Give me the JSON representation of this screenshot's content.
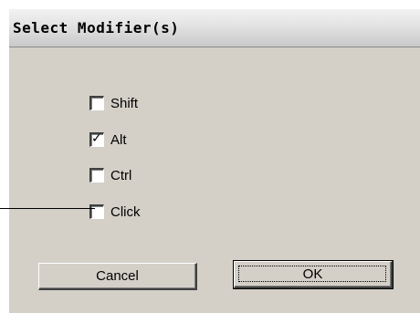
{
  "window": {
    "title": "Select Modifier(s)"
  },
  "modifiers": [
    {
      "label": "Shift",
      "checked": false
    },
    {
      "label": "Alt",
      "checked": true
    },
    {
      "label": "Ctrl",
      "checked": false
    },
    {
      "label": "Click",
      "checked": false
    }
  ],
  "buttons": {
    "cancel_label": "Cancel",
    "ok_label": "OK"
  },
  "colors": {
    "dialog_background": "#d4d0c8",
    "titlebar_gradient_top": "#f2f2f2",
    "titlebar_gradient_bottom": "#c9c9c9"
  }
}
